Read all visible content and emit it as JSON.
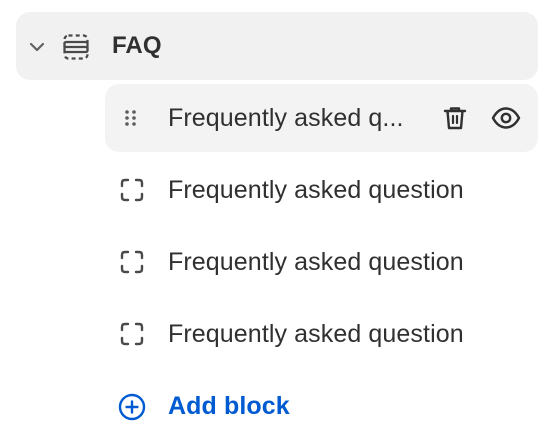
{
  "section": {
    "title": "FAQ",
    "chevron_icon": "chevron-down-icon",
    "section_icon": "section-icon"
  },
  "blocks": [
    {
      "label": "Frequently asked q...",
      "state": "hovered",
      "drag_icon": "drag-handle-icon",
      "delete_icon": "trash-icon",
      "visibility_icon": "eye-icon"
    },
    {
      "label": "Frequently asked question",
      "icon": "block-icon"
    },
    {
      "label": "Frequently asked question",
      "icon": "block-icon"
    },
    {
      "label": "Frequently asked question",
      "icon": "block-icon"
    }
  ],
  "add_block": {
    "label": "Add block",
    "icon": "plus-circle-icon",
    "color": "#005bd3"
  }
}
